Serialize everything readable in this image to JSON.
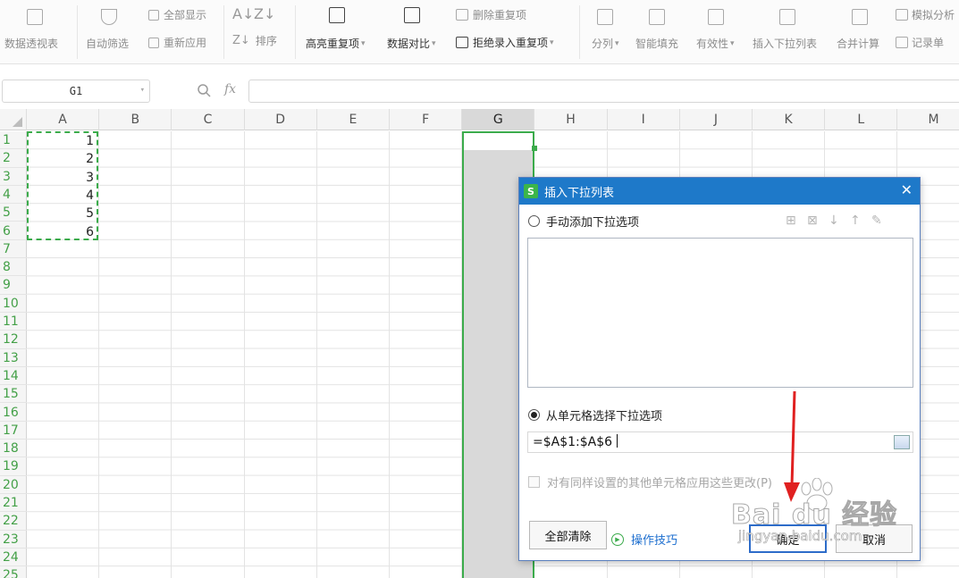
{
  "ribbon": {
    "pivot_label": "数据透视表",
    "autofilter_label": "自动筛选",
    "show_all_label": "全部显示",
    "reapply_label": "重新应用",
    "sort_label": "排序",
    "highlight_dup_label": "高亮重复项",
    "compare_label": "数据对比",
    "delete_dup_label": "删除重复项",
    "reject_dup_label": "拒绝录入重复项",
    "split_label": "分列",
    "smart_fill_label": "智能填充",
    "validity_label": "有效性",
    "insert_dropdown_label": "插入下拉列表",
    "consolidate_label": "合并计算",
    "simulate_label": "模拟分析",
    "record_label": "记录单"
  },
  "formula_bar": {
    "name_box": "G1",
    "fx": "fx",
    "formula": ""
  },
  "sheet": {
    "columns": [
      "A",
      "B",
      "C",
      "D",
      "E",
      "F",
      "G",
      "H",
      "I",
      "J",
      "K",
      "L",
      "M"
    ],
    "selected_column": "G",
    "rows": [
      "1",
      "2",
      "3",
      "4",
      "5",
      "6",
      "7",
      "8",
      "9",
      "10",
      "11",
      "12",
      "13",
      "14",
      "15",
      "16",
      "17",
      "18",
      "19",
      "20",
      "21",
      "22",
      "23",
      "24",
      "25"
    ],
    "a_values": [
      "1",
      "2",
      "3",
      "4",
      "5",
      "6"
    ]
  },
  "dialog": {
    "title": "插入下拉列表",
    "close": "✕",
    "option_manual": "手动添加下拉选项",
    "option_cells": "从单元格选择下拉选项",
    "range_value": "=$A$1:$A$6",
    "apply_same": "对有同样设置的其他单元格应用这些更改(P)",
    "clear_all": "全部清除",
    "tips": "操作技巧",
    "ok": "确定",
    "cancel": "取消",
    "selected_option": "cells"
  },
  "watermark": {
    "text": "Bai du 经验",
    "sub": "jingyan.baidu.com"
  },
  "colors": {
    "accent_green": "#3bab4b",
    "title_blue": "#1e79c9",
    "arrow_red": "#e02020"
  }
}
